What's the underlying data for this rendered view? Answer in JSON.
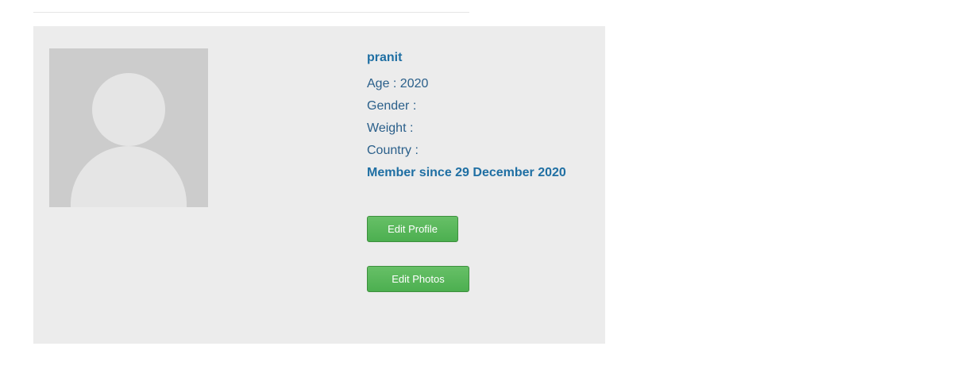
{
  "profile": {
    "username": "pranit",
    "age_text": "Age : 2020",
    "gender_text": "Gender :",
    "weight_text": "Weight :",
    "country_text": "Country :",
    "member_since_text": "Member since 29 December 2020"
  },
  "actions": {
    "edit_profile_label": "Edit Profile",
    "edit_photos_label": "Edit Photos"
  },
  "colors": {
    "card_background": "#ececec",
    "heading_blue": "#1f6fa3",
    "text_blue": "#2a5f8a",
    "button_green": "#4caf50",
    "avatar_placeholder": "#cccccc"
  },
  "icons": {
    "avatar": "default-user-avatar-icon"
  }
}
